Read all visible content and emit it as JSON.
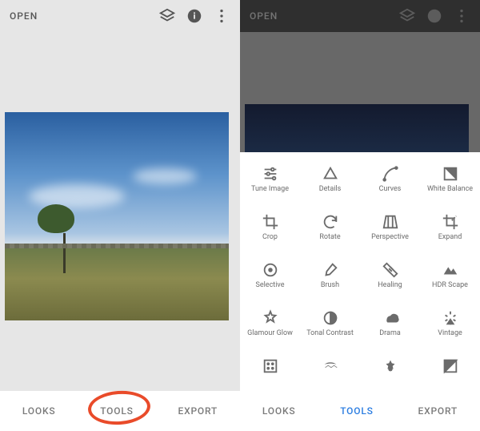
{
  "left": {
    "open_label": "OPEN",
    "bottom": {
      "looks": "LOOKS",
      "tools": "TOOLS",
      "export": "EXPORT"
    }
  },
  "right": {
    "open_label": "OPEN",
    "bottom": {
      "looks": "LOOKS",
      "tools": "TOOLS",
      "export": "EXPORT"
    },
    "tools": [
      {
        "label": "Tune Image",
        "icon": "tune"
      },
      {
        "label": "Details",
        "icon": "details"
      },
      {
        "label": "Curves",
        "icon": "curves"
      },
      {
        "label": "White Balance",
        "icon": "white-balance"
      },
      {
        "label": "Crop",
        "icon": "crop"
      },
      {
        "label": "Rotate",
        "icon": "rotate"
      },
      {
        "label": "Perspective",
        "icon": "perspective"
      },
      {
        "label": "Expand",
        "icon": "expand"
      },
      {
        "label": "Selective",
        "icon": "selective"
      },
      {
        "label": "Brush",
        "icon": "brush"
      },
      {
        "label": "Healing",
        "icon": "healing"
      },
      {
        "label": "HDR Scape",
        "icon": "hdr-scape"
      },
      {
        "label": "Glamour Glow",
        "icon": "glamour-glow"
      },
      {
        "label": "Tonal Contrast",
        "icon": "tonal-contrast"
      },
      {
        "label": "Drama",
        "icon": "drama"
      },
      {
        "label": "Vintage",
        "icon": "vintage"
      },
      {
        "label": "",
        "icon": "grainy-film"
      },
      {
        "label": "",
        "icon": "retrolux"
      },
      {
        "label": "",
        "icon": "grunge"
      },
      {
        "label": "",
        "icon": "black-white"
      }
    ]
  }
}
